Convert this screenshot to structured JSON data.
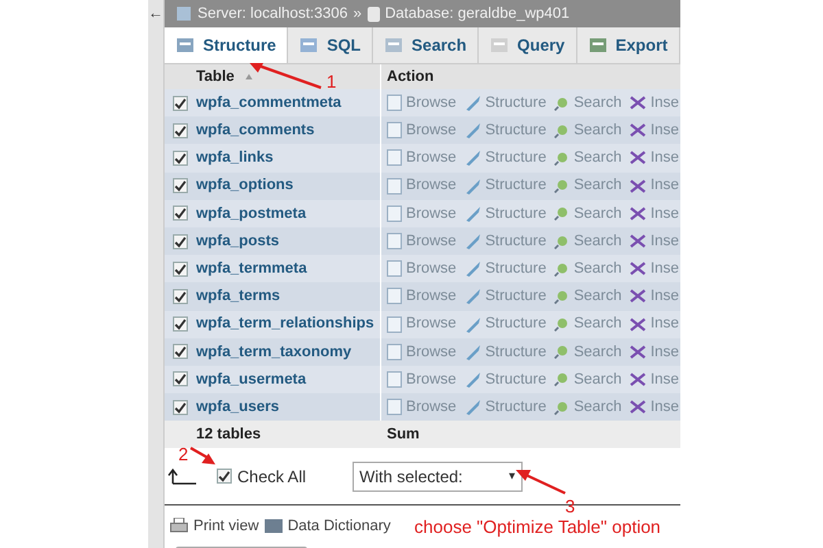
{
  "breadcrumb": {
    "back": "←",
    "server": "Server: localhost:3306",
    "separator": "»",
    "database": "Database: geraldbe_wp401"
  },
  "tabs": [
    {
      "label": "Structure",
      "selected": true
    },
    {
      "label": "SQL",
      "selected": false
    },
    {
      "label": "Search",
      "selected": false
    },
    {
      "label": "Query",
      "selected": false
    },
    {
      "label": "Export",
      "selected": false
    }
  ],
  "table": {
    "columns": [
      "Table",
      "Action"
    ],
    "rows": [
      {
        "name": "wpfa_commentmeta",
        "checked": true,
        "actions": [
          "Browse",
          "Structure",
          "Search",
          "Inse"
        ]
      },
      {
        "name": "wpfa_comments",
        "checked": true,
        "actions": [
          "Browse",
          "Structure",
          "Search",
          "Inse"
        ]
      },
      {
        "name": "wpfa_links",
        "checked": true,
        "actions": [
          "Browse",
          "Structure",
          "Search",
          "Inse"
        ]
      },
      {
        "name": "wpfa_options",
        "checked": true,
        "actions": [
          "Browse",
          "Structure",
          "Search",
          "Inse"
        ]
      },
      {
        "name": "wpfa_postmeta",
        "checked": true,
        "actions": [
          "Browse",
          "Structure",
          "Search",
          "Inse"
        ]
      },
      {
        "name": "wpfa_posts",
        "checked": true,
        "actions": [
          "Browse",
          "Structure",
          "Search",
          "Inse"
        ]
      },
      {
        "name": "wpfa_termmeta",
        "checked": true,
        "actions": [
          "Browse",
          "Structure",
          "Search",
          "Inse"
        ]
      },
      {
        "name": "wpfa_terms",
        "checked": true,
        "actions": [
          "Browse",
          "Structure",
          "Search",
          "Inse"
        ]
      },
      {
        "name": "wpfa_term_relationships",
        "checked": true,
        "actions": [
          "Browse",
          "Structure",
          "Search",
          "Inse"
        ]
      },
      {
        "name": "wpfa_term_taxonomy",
        "checked": true,
        "actions": [
          "Browse",
          "Structure",
          "Search",
          "Inse"
        ]
      },
      {
        "name": "wpfa_usermeta",
        "checked": true,
        "actions": [
          "Browse",
          "Structure",
          "Search",
          "Inse"
        ]
      },
      {
        "name": "wpfa_users",
        "checked": true,
        "actions": [
          "Browse",
          "Structure",
          "Search",
          "Inse"
        ]
      }
    ],
    "footer": {
      "count": "12 tables",
      "sum": "Sum"
    }
  },
  "check_all": {
    "label": "Check All",
    "checked": true
  },
  "with_selected": {
    "value": "With selected:",
    "caret": "▾"
  },
  "links": [
    "Print view",
    "Data Dictionary"
  ],
  "annotations": {
    "step_1": "1",
    "step_2": "2",
    "step_3": "3",
    "note": "choose \"Optimize Table\" option"
  }
}
